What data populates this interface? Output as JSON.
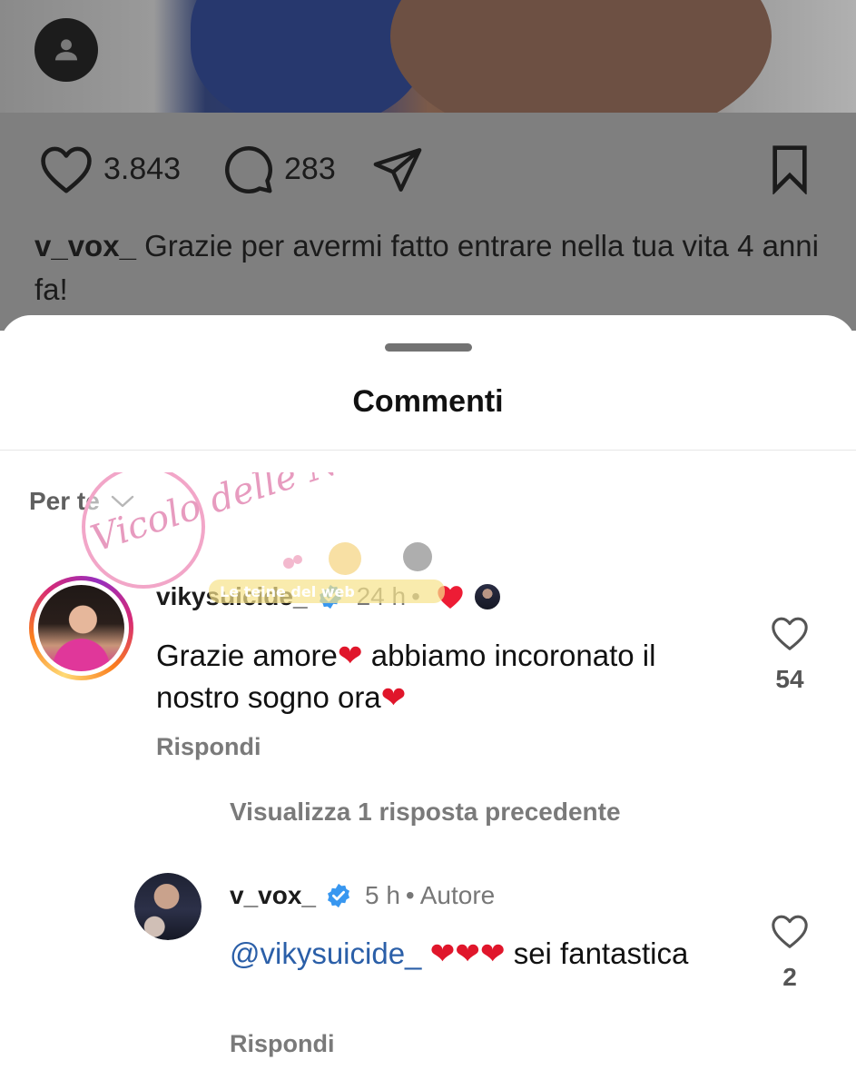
{
  "post": {
    "likes": "3.843",
    "comments": "283",
    "caption_user": "v_vox_",
    "caption_text": " Grazie per avermi fatto entrare nella tua vita 4 anni fa!"
  },
  "sheet": {
    "title": "Commenti",
    "sort_label": "Per te"
  },
  "comments": [
    {
      "username": "vikysuicide_",
      "time": "24 h",
      "text_a": "Grazie amore",
      "text_b": " abbiamo incoronato il nostro sogno ora",
      "heart": "❤",
      "reply_label": "Rispondi",
      "likes": "54"
    }
  ],
  "view_more": "Visualizza 1 risposta precedente",
  "reply": {
    "username": "v_vox_",
    "time": "5 h",
    "author_label": "Autore",
    "mention": "@vikysuicide_",
    "hearts": "❤❤❤",
    "text": " sei fantastica",
    "reply_label": "Rispondi",
    "likes": "2"
  },
  "watermark": {
    "brand": "Vicolo delle News",
    "tag": "Le teine del web"
  },
  "icons": [
    "user-icon",
    "heart-icon",
    "comment-icon",
    "share-icon",
    "bookmark-icon",
    "verified-icon",
    "chevron-down-icon"
  ],
  "colors": {
    "verified": "#3897f0",
    "heart_emoji": "#e0162b",
    "mention": "#2b5fa8"
  }
}
